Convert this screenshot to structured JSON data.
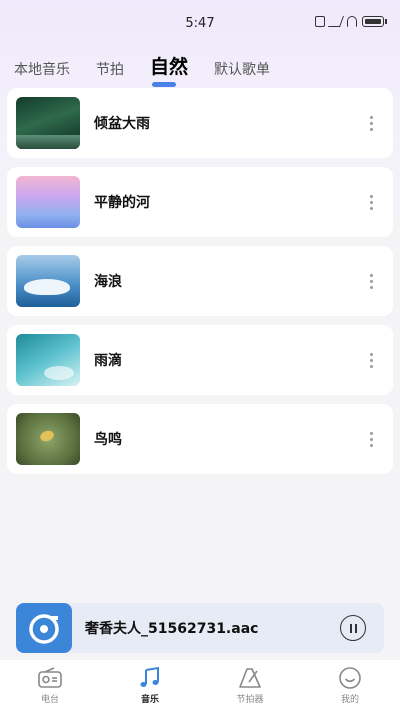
{
  "status": {
    "time": "5:47"
  },
  "tabs": [
    {
      "label": "本地音乐"
    },
    {
      "label": "节拍"
    },
    {
      "label": "自然"
    },
    {
      "label": "默认歌单"
    }
  ],
  "tracks": [
    {
      "title": "倾盆大雨"
    },
    {
      "title": "平静的河"
    },
    {
      "title": "海浪"
    },
    {
      "title": "雨滴"
    },
    {
      "title": "鸟鸣"
    }
  ],
  "player": {
    "title": "奢香夫人_51562731.aac"
  },
  "nav": [
    {
      "label": "电台"
    },
    {
      "label": "音乐"
    },
    {
      "label": "节拍器"
    },
    {
      "label": "我的"
    }
  ],
  "colors": {
    "accent": "#4a83e8",
    "player_bg": "#e6ebf6",
    "cover": "#3b86d8"
  }
}
